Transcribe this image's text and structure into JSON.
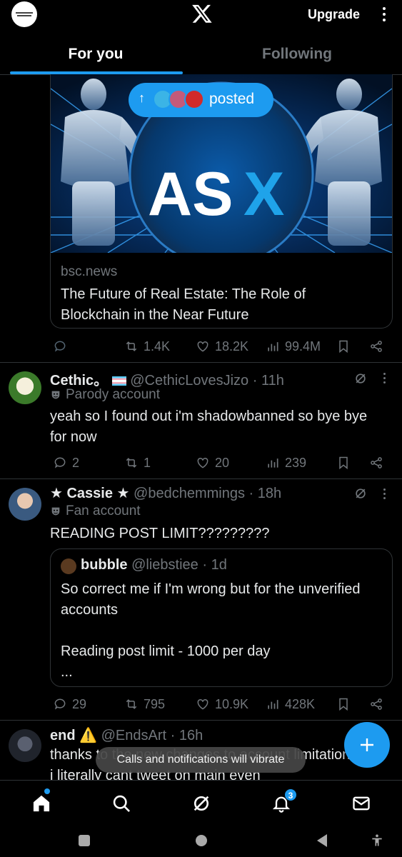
{
  "header": {
    "upgrade_label": "Upgrade",
    "tabs": [
      {
        "label": "For you",
        "active": true
      },
      {
        "label": "Following",
        "active": false
      }
    ]
  },
  "colors": {
    "accent": "#1d9bf0",
    "background": "#000000",
    "muted": "#71767b",
    "divider": "#2f3336"
  },
  "promoted_card": {
    "posted_label": "posted",
    "image_text": {
      "as": "AS",
      "x": "X"
    },
    "domain": "bsc.news",
    "title": "The Future of Real Estate: The Role of Blockchain in the Near Future",
    "stats": {
      "reposts": "1.4K",
      "likes": "18.2K",
      "views": "99.4M"
    }
  },
  "posts": [
    {
      "name": "Cethic。",
      "handle": "@CethicLovesJizo",
      "time": "· 11h",
      "tag_icon": "parody-mask-icon",
      "tag": "Parody account",
      "text": "yeah so I found out i'm shadowbanned so bye bye for now",
      "stats": {
        "replies": "2",
        "reposts": "1",
        "likes": "20",
        "views": "239"
      }
    },
    {
      "name": "★ Cassie ★",
      "handle": "@bedchemmings",
      "time": "· 18h",
      "tag_icon": "fan-mask-icon",
      "tag": "Fan account",
      "text": "READING POST LIMIT?????????",
      "quote": {
        "name": "bubble",
        "handle": "@liebstiee",
        "time": "· 1d",
        "text": "So correct me if I'm wrong but for the unverified accounts\n\nReading post limit - 1000 per day\n..."
      },
      "stats": {
        "replies": "29",
        "reposts": "795",
        "likes": "10.9K",
        "views": "428K"
      }
    },
    {
      "name": "end",
      "warning_emoji": "⚠️",
      "handle": "@EndsArt",
      "time": "· 16h",
      "text": "thanks to the new changes to account limitations i literally cant tweet on main even"
    }
  ],
  "toast": "Calls and notifications will vibrate",
  "bottom_nav": {
    "items": [
      "home-icon",
      "search-icon",
      "grok-icon",
      "notifications-icon",
      "messages-icon"
    ],
    "notification_count": "3"
  }
}
